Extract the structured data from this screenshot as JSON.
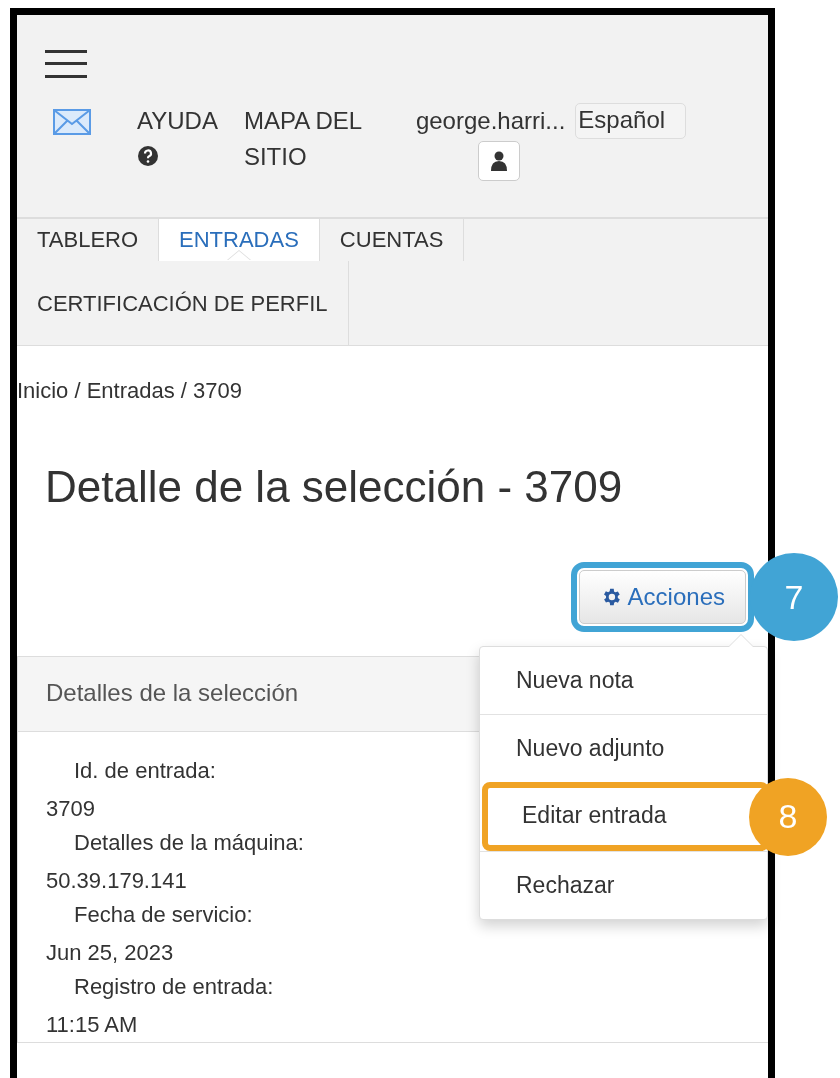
{
  "header": {
    "help": "AYUDA",
    "sitemap": "MAPA DEL SITIO",
    "user": "george.harri...",
    "language": "Español"
  },
  "tabs": [
    {
      "label": "TABLERO",
      "selected": false
    },
    {
      "label": "ENTRADAS",
      "selected": true
    },
    {
      "label": "CUENTAS",
      "selected": false
    },
    {
      "label": "CERTIFICACIÓN DE PERFIL",
      "selected": false
    }
  ],
  "breadcrumb": "Inicio / Entradas / 3709",
  "title": "Detalle de la selección - 3709",
  "actions": {
    "label": "Acciones",
    "callout": {
      "label": "7",
      "color": "#41a4d5"
    }
  },
  "menu": [
    {
      "label": "Nueva nota"
    },
    {
      "label": "Nuevo adjunto"
    },
    {
      "label": "Editar entrada",
      "callout": {
        "label": "8",
        "color": "#f0a324"
      }
    },
    {
      "label": "Rechazar"
    }
  ],
  "panel": {
    "heading": "Detalles de la selección",
    "fields": [
      {
        "label": "Id. de entrada:",
        "value": "3709"
      },
      {
        "label": "Detalles de la máquina:",
        "value": "50.39.179.141"
      },
      {
        "label": "Fecha de servicio:",
        "value": "Jun 25, 2023"
      },
      {
        "label": "Registro de entrada:",
        "value": "11:15 AM"
      }
    ]
  }
}
